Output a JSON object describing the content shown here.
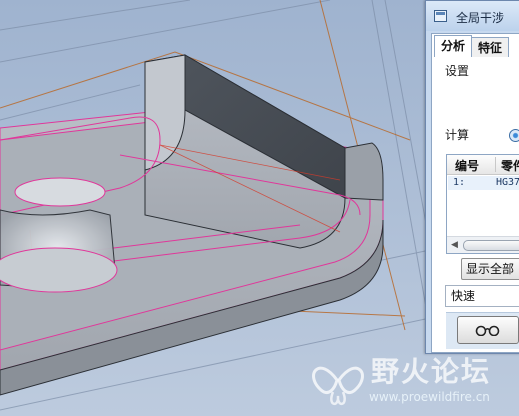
{
  "dialog": {
    "title": "全局干涉",
    "tabs": [
      {
        "label": "分析"
      },
      {
        "label": "特征"
      }
    ],
    "settings_label": "设置",
    "compute_label": "计算",
    "table": {
      "columns": [
        "编号",
        "零件"
      ],
      "rows": [
        {
          "id": "1:",
          "part": "HG37"
        }
      ]
    },
    "show_all_label": "显示全部",
    "mode_value": "快速",
    "glasses_icon": "glasses-icon"
  },
  "watermark": {
    "brand": "野火论坛",
    "url": "www.proewildfire.cn"
  },
  "colors": {
    "viewport_bg": "#aebfd6",
    "part_shade": "#4a4f57",
    "highlight_edge": "#e0379a",
    "datum_plane": "#b85f1c"
  }
}
